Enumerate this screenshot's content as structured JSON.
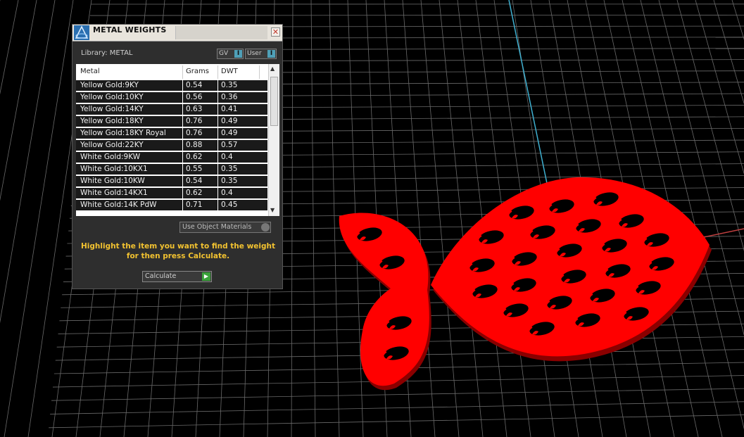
{
  "viewport": {
    "background": "#000000",
    "grid_color": "#6a6a6a",
    "axis_colors": {
      "y_axis": "#3fb0d0",
      "x_axis": "#c04040"
    },
    "model": {
      "name": "fish-pendant",
      "color": "#ff0000",
      "edge_color": "#a00000"
    }
  },
  "dialog": {
    "title": "METAL WEIGHTS",
    "close_icon": "close-icon",
    "library_label": "Library: METAL",
    "mode_buttons": [
      {
        "label": "GV",
        "indicator": "I"
      },
      {
        "label": "User",
        "indicator": "I"
      }
    ],
    "table": {
      "columns": [
        "Metal",
        "Grams",
        "DWT"
      ],
      "rows": [
        [
          "Yellow Gold:9KY",
          "0.54",
          "0.35"
        ],
        [
          "Yellow Gold:10KY",
          "0.56",
          "0.36"
        ],
        [
          "Yellow Gold:14KY",
          "0.63",
          "0.41"
        ],
        [
          "Yellow Gold:18KY",
          "0.76",
          "0.49"
        ],
        [
          "Yellow Gold:18KY Royal",
          "0.76",
          "0.49"
        ],
        [
          "Yellow Gold:22KY",
          "0.88",
          "0.57"
        ],
        [
          "White Gold:9KW",
          "0.62",
          "0.4"
        ],
        [
          "White Gold:10KX1",
          "0.55",
          "0.35"
        ],
        [
          "White Gold:10KW",
          "0.54",
          "0.35"
        ],
        [
          "White Gold:14KX1",
          "0.62",
          "0.4"
        ],
        [
          "White Gold:14K PdW",
          "0.71",
          "0.45"
        ]
      ]
    },
    "materials_dropdown": {
      "value": "Use Object Materials"
    },
    "hint_lines": [
      "Highlight the item you want to find the weight",
      "for then press Calculate."
    ],
    "calculate_button": {
      "label": "Calculate"
    },
    "colors": {
      "hint": "#f2c230",
      "panel": "#2e2e2e",
      "row_bg": "#1a1a1a",
      "accent": "#4fa0b8",
      "go": "#3aa13a"
    }
  }
}
